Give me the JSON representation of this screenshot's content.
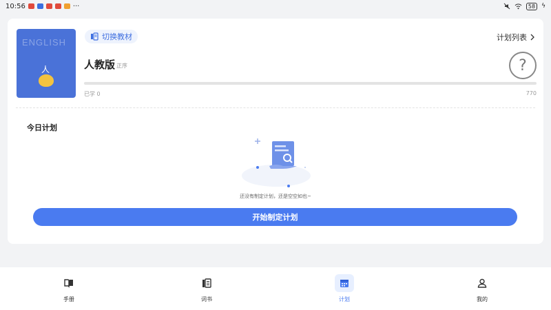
{
  "status_bar": {
    "time": "10:56",
    "dots": "···",
    "battery": "58"
  },
  "book": {
    "cover_text": "ENGLISH",
    "cover_glyph": "人"
  },
  "switch_button": {
    "label": "切换教材"
  },
  "plan_list": {
    "label": "计划列表"
  },
  "edition": {
    "name": "人教版",
    "tag": "正序"
  },
  "progress": {
    "learned_label": "已学 0",
    "learned": 0,
    "total": 770
  },
  "today_plan": {
    "title": "今日计划",
    "empty_text": "还没有制定计划，还是空空如也~"
  },
  "start_button": {
    "label": "开始制定计划"
  },
  "nav": {
    "items": [
      {
        "label": "手册",
        "icon": "book-icon",
        "active": false
      },
      {
        "label": "词书",
        "icon": "wordbook-icon",
        "active": false
      },
      {
        "label": "计划",
        "icon": "calendar-icon",
        "active": true
      },
      {
        "label": "我的",
        "icon": "person-icon",
        "active": false
      }
    ]
  },
  "colors": {
    "accent": "#4a7bf0",
    "cover": "#4a72d8"
  }
}
